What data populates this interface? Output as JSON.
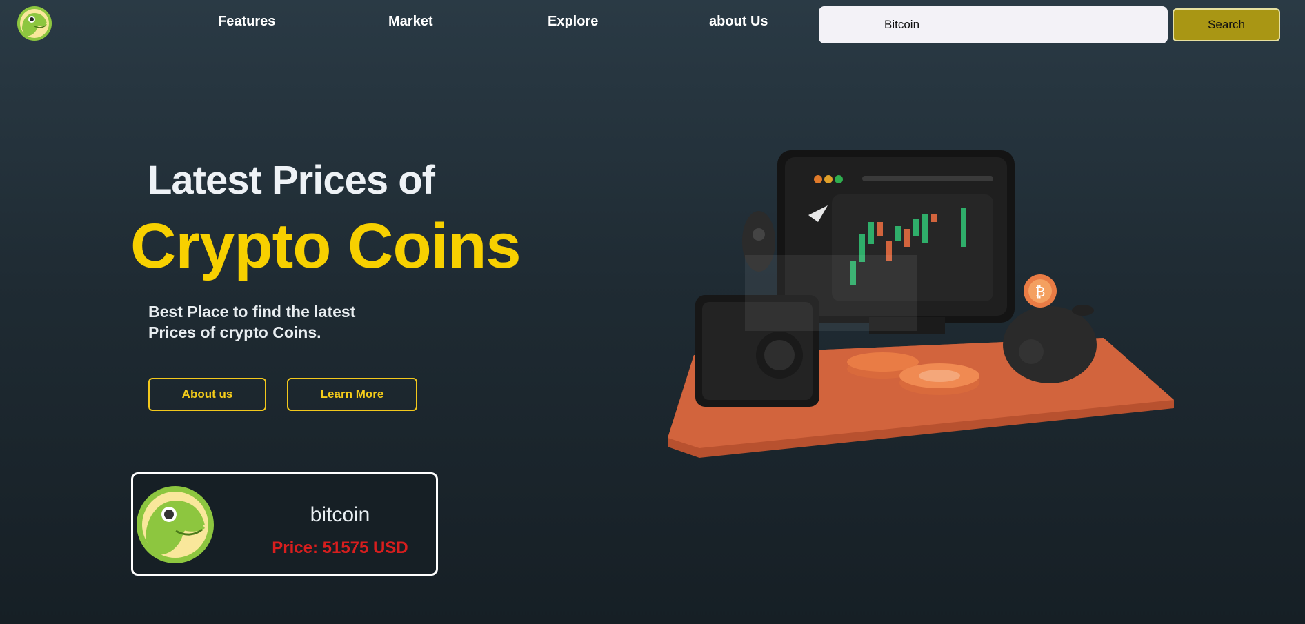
{
  "nav": {
    "logo_icon": "gecko-logo-icon",
    "links": [
      {
        "label": "Features"
      },
      {
        "label": "Market"
      },
      {
        "label": "Explore"
      },
      {
        "label": "about Us"
      }
    ],
    "search": {
      "value": "Bitcoin",
      "button_label": "Search"
    }
  },
  "hero": {
    "title_line1": "Latest Prices of",
    "title_line2": "Crypto Coins",
    "subtitle_line1": "Best Place to find the latest",
    "subtitle_line2": "Prices of crypto Coins.",
    "buttons": {
      "about": "About us",
      "learn": "Learn More"
    },
    "illustration_icon": "crypto-trading-illustration-icon"
  },
  "coin_card": {
    "icon": "gecko-coin-logo-icon",
    "name": "bitcoin",
    "price": "Price: 51575 USD"
  },
  "colors": {
    "accent_yellow": "#f7d000",
    "search_button": "#a99614",
    "price_red": "#d81e1e",
    "background_dark": "#1f2b33"
  }
}
